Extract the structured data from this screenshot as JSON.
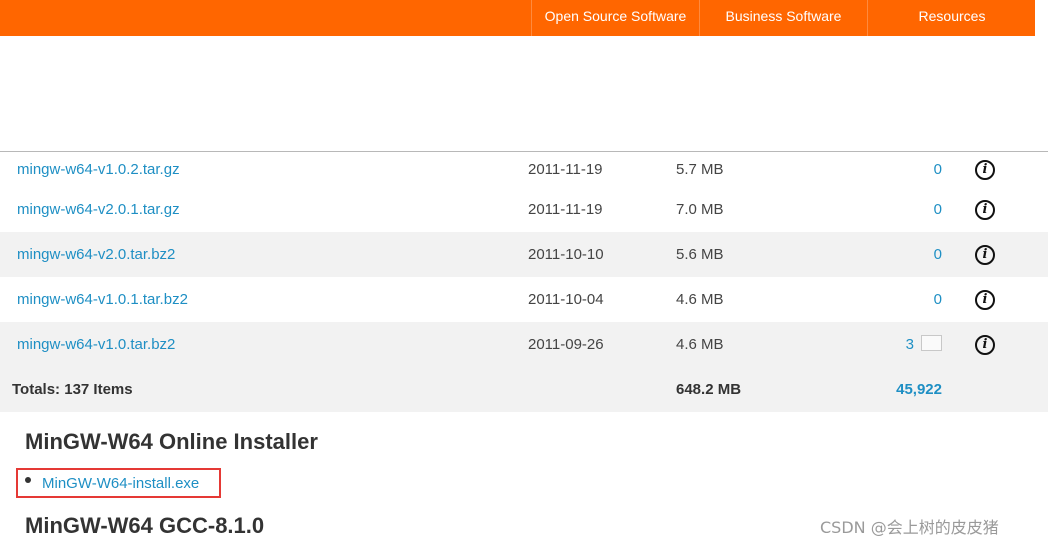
{
  "nav": {
    "items": [
      {
        "label": "Open Source Software"
      },
      {
        "label": "Business Software"
      },
      {
        "label": "Resources"
      }
    ]
  },
  "files": {
    "rows": [
      {
        "name": "mingw-w64-v1.0.2.tar.gz",
        "date": "2011-11-19",
        "size": "5.7 MB",
        "downloads": "0"
      },
      {
        "name": "mingw-w64-v2.0.1.tar.gz",
        "date": "2011-11-19",
        "size": "7.0 MB",
        "downloads": "0"
      },
      {
        "name": "mingw-w64-v2.0.tar.bz2",
        "date": "2011-10-10",
        "size": "5.6 MB",
        "downloads": "0"
      },
      {
        "name": "mingw-w64-v1.0.1.tar.bz2",
        "date": "2011-10-04",
        "size": "4.6 MB",
        "downloads": "0"
      },
      {
        "name": "mingw-w64-v1.0.tar.bz2",
        "date": "2011-09-26",
        "size": "4.6 MB",
        "downloads": "3"
      }
    ],
    "info_icon": "i",
    "totals": {
      "label": "Totals: 137 Items",
      "size": "648.2 MB",
      "downloads": "45,922"
    }
  },
  "sections": {
    "online_installer": {
      "title": "MinGW-W64 Online Installer",
      "link": "MinGW-W64-install.exe"
    },
    "gcc": {
      "title": "MinGW-W64 GCC-8.1.0"
    }
  },
  "watermark": "CSDN @会上树的皮皮猪",
  "colors": {
    "brand": "#ff6600",
    "link": "#1e8fc4",
    "highlight": "#e53935"
  }
}
